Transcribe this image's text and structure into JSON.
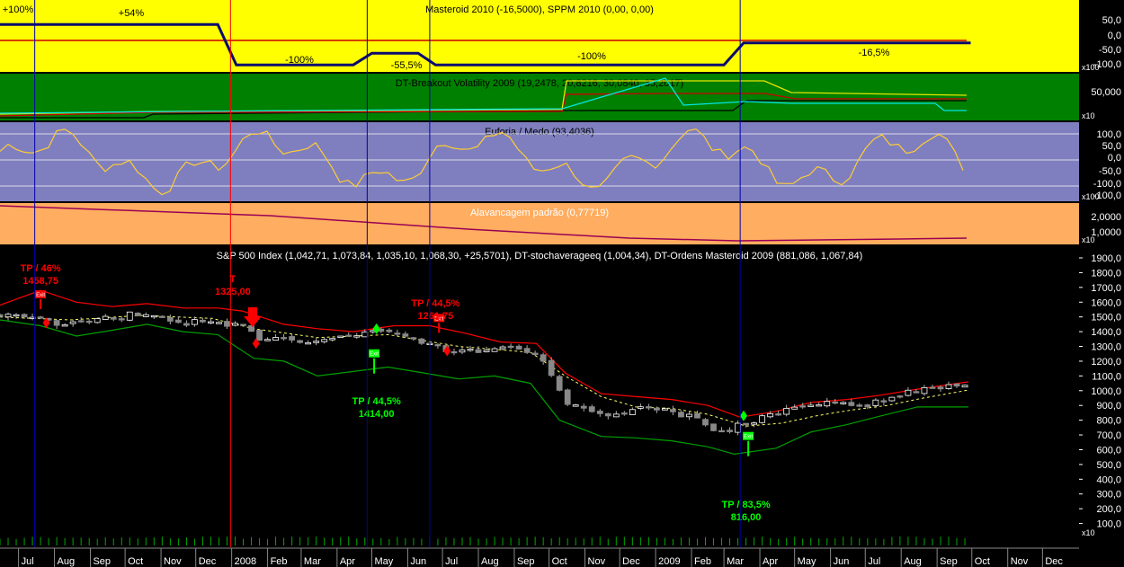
{
  "colors": {
    "panel1_bg": "#ffff00",
    "panel2_bg": "#008000",
    "panel3_bg": "#7f7fbf",
    "panel4_bg": "#ffad60",
    "main_bg": "#000000",
    "blue_line": "#0000aa",
    "red_line": "#ff0000",
    "green_line": "#00c000"
  },
  "chart_data": [
    {
      "type": "line",
      "title": "Masteroid 2010 (-16,5000), SPPM 2010 (0,00, 0,00)",
      "y_ticks": [
        "50,0",
        "0,0",
        "-50,0",
        "-100,0"
      ],
      "ylim": [
        -100,
        100
      ],
      "scale_label": "x100",
      "position_labels": [
        "+100%",
        "+54%",
        "-100%",
        "-55,5%",
        "-100%",
        "-16,5%"
      ],
      "series": [
        {
          "color": "#0a0a6e",
          "x": [
            "2007-06-15",
            "2007-07-15",
            "2007-12-20",
            "2008-01-05",
            "2008-04-15",
            "2008-05-01",
            "2008-06-10",
            "2008-06-25",
            "2009-03-01",
            "2009-03-18",
            "2009-09-30"
          ],
          "values": [
            54,
            54,
            54,
            -100,
            -100,
            -55.5,
            -55.5,
            -100,
            -100,
            -16.5,
            -16.5
          ]
        }
      ]
    },
    {
      "type": "line",
      "title": "DT-Breakout Volatility 2009 (19,2478, 20,8216, 30,0840, 35,2017)",
      "y_ticks": [
        "50,000"
      ],
      "scale_label": "x10",
      "values_current": [
        19.2478,
        20.8216,
        30.084,
        35.2017
      ]
    },
    {
      "type": "line",
      "title": "Euforia / Medo (93,4036)",
      "y_ticks": [
        "100,0",
        "50,0",
        "0,0",
        "-50,0",
        "-100,0",
        "-100,0"
      ],
      "ylim": [
        -150,
        150
      ],
      "scale_label": "x100",
      "current": 93.4036
    },
    {
      "type": "line",
      "title": "Alavancagem padrão (0,77719)",
      "y_ticks": [
        "2,0000",
        "1,0000"
      ],
      "scale_label": "x10",
      "current": 0.77719
    },
    {
      "type": "candlestick",
      "title": "S&P 500 Index (1,042,71, 1,073,84, 1,035,10, 1,068,30, +25,5701), DT-stochaverageeq (1,004,34), DT-Ordens Masteroid 2009 (881,086, 1,067,84)",
      "ylim": [
        0,
        1900
      ],
      "y_ticks": [
        "1900,0",
        "1800,0",
        "1700,0",
        "1600,0",
        "1500,0",
        "1400,0",
        "1300,0",
        "1200,0",
        "1100,0",
        "1000,0",
        "900,0",
        "800,0",
        "700,0",
        "600,0",
        "500,0",
        "400,0",
        "300,0",
        "200,0",
        "100,0"
      ],
      "x_ticks": [
        "Jul",
        "Aug",
        "Sep",
        "Oct",
        "Nov",
        "Dec",
        "2008",
        "Feb",
        "Mar",
        "Apr",
        "May",
        "Jun",
        "Jul",
        "Aug",
        "Sep",
        "Oct",
        "Nov",
        "Dec",
        "2009",
        "Feb",
        "Mar",
        "Apr",
        "May",
        "Jun",
        "Jul",
        "Aug",
        "Sep",
        "Oct",
        "Nov",
        "Dec"
      ],
      "scale_label": "x10",
      "close_series": {
        "x": [
          "2007-06-15",
          "2007-07-15",
          "2007-08-15",
          "2007-09-15",
          "2007-10-15",
          "2007-11-15",
          "2007-12-15",
          "2008-01-10",
          "2008-01-25",
          "2008-02-15",
          "2008-03-15",
          "2008-04-15",
          "2008-05-15",
          "2008-06-15",
          "2008-07-10",
          "2008-08-15",
          "2008-09-10",
          "2008-09-30",
          "2008-10-15",
          "2008-11-01",
          "2008-11-20",
          "2008-12-15",
          "2009-01-10",
          "2009-02-10",
          "2009-03-01",
          "2009-03-10",
          "2009-04-01",
          "2009-05-01",
          "2009-06-01",
          "2009-07-01",
          "2009-08-01",
          "2009-09-01",
          "2009-09-28"
        ],
        "values": [
          1520,
          1480,
          1450,
          1490,
          1530,
          1460,
          1470,
          1440,
          1340,
          1360,
          1320,
          1380,
          1400,
          1330,
          1250,
          1290,
          1280,
          1160,
          920,
          890,
          820,
          880,
          870,
          800,
          700,
          760,
          810,
          880,
          920,
          900,
          980,
          1020,
          1060
        ]
      },
      "upper_band": {
        "x": [
          "2007-06-15",
          "2007-07-20",
          "2007-08-20",
          "2007-09-20",
          "2007-10-20",
          "2007-11-20",
          "2007-12-20",
          "2008-01-10",
          "2008-02-15",
          "2008-03-15",
          "2008-04-15",
          "2008-05-20",
          "2008-06-20",
          "2008-07-20",
          "2008-08-20",
          "2008-09-20",
          "2008-10-15",
          "2008-11-15",
          "2008-12-15",
          "2009-01-15",
          "2009-02-15",
          "2009-03-15",
          "2009-04-15",
          "2009-05-15",
          "2009-06-15",
          "2009-07-15",
          "2009-08-15",
          "2009-09-28"
        ],
        "values": [
          1580,
          1680,
          1600,
          1570,
          1590,
          1560,
          1560,
          1540,
          1450,
          1420,
          1400,
          1440,
          1440,
          1390,
          1330,
          1320,
          1120,
          980,
          960,
          940,
          900,
          820,
          860,
          920,
          940,
          970,
          1010,
          1060
        ]
      },
      "lower_band": {
        "x": [
          "2007-06-15",
          "2007-07-20",
          "2007-08-20",
          "2007-09-20",
          "2007-10-20",
          "2007-11-20",
          "2007-12-20",
          "2008-01-20",
          "2008-02-15",
          "2008-03-15",
          "2008-04-15",
          "2008-05-15",
          "2008-06-15",
          "2008-07-15",
          "2008-08-15",
          "2008-09-15",
          "2008-10-10",
          "2008-11-15",
          "2008-12-15",
          "2009-01-15",
          "2009-02-15",
          "2009-03-10",
          "2009-04-15",
          "2009-05-15",
          "2009-06-15",
          "2009-07-15",
          "2009-08-15",
          "2009-09-28"
        ],
        "values": [
          1480,
          1440,
          1370,
          1410,
          1450,
          1400,
          1380,
          1220,
          1200,
          1100,
          1130,
          1160,
          1120,
          1080,
          1100,
          1050,
          800,
          690,
          680,
          660,
          620,
          570,
          610,
          720,
          770,
          830,
          890,
          890
        ]
      },
      "stoch_average": {
        "x": [
          "2007-06-15",
          "2007-08-15",
          "2007-10-15",
          "2007-12-15",
          "2008-01-20",
          "2008-03-15",
          "2008-05-15",
          "2008-07-15",
          "2008-09-15",
          "2008-10-15",
          "2008-11-15",
          "2008-12-15",
          "2009-01-15",
          "2009-02-15",
          "2009-03-20",
          "2009-04-20",
          "2009-05-20",
          "2009-06-20",
          "2009-07-20",
          "2009-08-20",
          "2009-09-28"
        ],
        "values": [
          1500,
          1480,
          1510,
          1490,
          1420,
          1360,
          1380,
          1300,
          1260,
          1100,
          960,
          890,
          880,
          840,
          760,
          780,
          830,
          870,
          900,
          950,
          1004.34
        ]
      },
      "annotations": [
        {
          "text_top": "TP / 46%",
          "text_bottom": "1458,75",
          "date": "2007-07-20",
          "price": 1458.75,
          "color": "#ff0000",
          "placement": "above"
        },
        {
          "text_top": "T",
          "text_bottom": "1325,00",
          "date": "2008-01-02",
          "price": 1325,
          "color": "#ff0000",
          "placement": "above"
        },
        {
          "text_top": "TP / 44,5%",
          "text_bottom": "1261,75",
          "date": "2008-06-25",
          "price": 1261.75,
          "color": "#ff0000",
          "placement": "above"
        },
        {
          "text_top": "TP / 44,5%",
          "text_bottom": "1414,00",
          "date": "2008-05-05",
          "price": 1414,
          "color": "#00ff00",
          "placement": "below"
        },
        {
          "text_top": "TP / 83,5%",
          "text_bottom": "816,00",
          "date": "2009-03-20",
          "price": 816,
          "color": "#00ff00",
          "placement": "below"
        }
      ],
      "entry_marks": [
        {
          "date": "2007-07-25",
          "price": 1460,
          "color": "#ff0000",
          "kind": "diamond"
        },
        {
          "date": "2008-01-22",
          "price": 1320,
          "color": "#ff0000",
          "kind": "diamond"
        },
        {
          "date": "2008-07-05",
          "price": 1270,
          "color": "#ff0000",
          "kind": "diamond"
        },
        {
          "date": "2008-05-05",
          "price": 1420,
          "color": "#00ff00",
          "kind": "diamond"
        },
        {
          "date": "2009-03-18",
          "price": 830,
          "color": "#00ff00",
          "kind": "diamond"
        }
      ],
      "exit_marks": [
        {
          "date": "2007-07-20",
          "price": 1650,
          "color": "#ff0000",
          "label": "Exit"
        },
        {
          "date": "2008-06-28",
          "price": 1490,
          "color": "#ff0000",
          "label": "Exit"
        },
        {
          "date": "2008-05-03",
          "price": 1250,
          "color": "#00ff00",
          "label": "Exit"
        },
        {
          "date": "2009-03-22",
          "price": 690,
          "color": "#00ff00",
          "label": "Exit"
        }
      ],
      "vertical_lines": [
        {
          "date": "2007-07-15",
          "color": "#0000aa"
        },
        {
          "date": "2007-12-31",
          "color": "#ff0000"
        },
        {
          "date": "2008-04-27",
          "color": "#0000aa"
        },
        {
          "date": "2008-06-20",
          "color": "#0000aa"
        },
        {
          "date": "2009-03-15",
          "color": "#0000aa"
        }
      ]
    }
  ]
}
